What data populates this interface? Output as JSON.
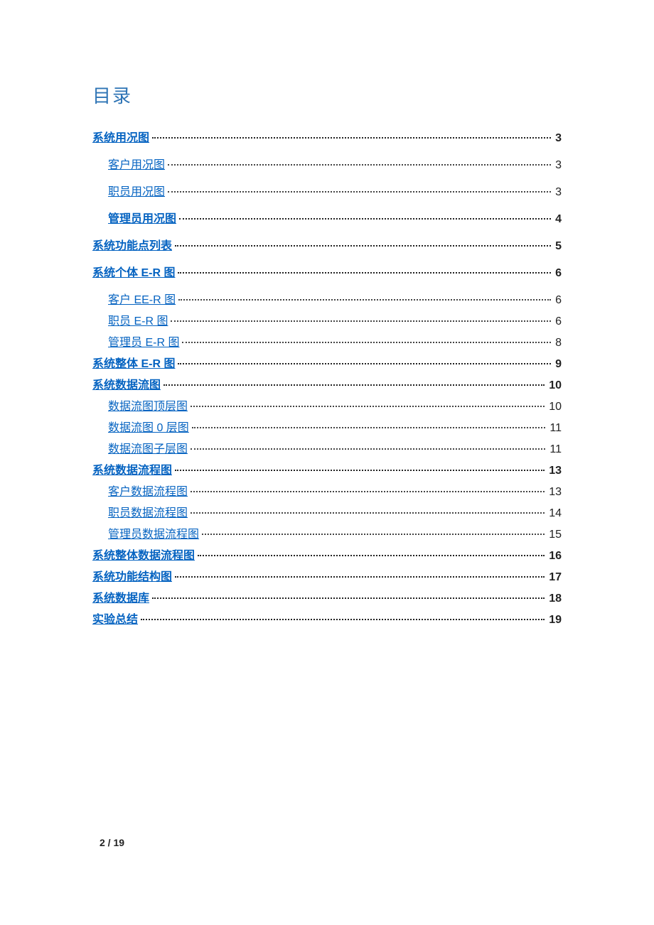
{
  "title": "目录",
  "entries": [
    {
      "label": "系统用况图",
      "page": "3",
      "level": 1,
      "bold": true,
      "spaced": true
    },
    {
      "label": "客户用况图",
      "page": "3",
      "level": 2,
      "bold": false,
      "spaced": true
    },
    {
      "label": "职员用况图",
      "page": "3",
      "level": 2,
      "bold": false,
      "spaced": true
    },
    {
      "label": "管理员用况图",
      "page": "4",
      "level": 2,
      "bold": true,
      "spaced": true
    },
    {
      "label": "系统功能点列表",
      "page": "5",
      "level": 1,
      "bold": true,
      "spaced": true
    },
    {
      "label": "系统个体 E-R 图",
      "page": "6",
      "level": 1,
      "bold": true,
      "spaced": true
    },
    {
      "label": "客户 EE-R 图",
      "page": "6",
      "level": 2,
      "bold": false,
      "spaced": false
    },
    {
      "label": "职员 E-R 图",
      "page": "6",
      "level": 2,
      "bold": false,
      "spaced": false
    },
    {
      "label": "管理员 E-R 图",
      "page": "8",
      "level": 2,
      "bold": false,
      "spaced": false
    },
    {
      "label": "系统整体 E-R 图",
      "page": "9",
      "level": 1,
      "bold": true,
      "spaced": false
    },
    {
      "label": "系统数据流图",
      "page": "10",
      "level": 1,
      "bold": true,
      "spaced": false
    },
    {
      "label": "数据流图顶层图",
      "page": "10",
      "level": 2,
      "bold": false,
      "spaced": false
    },
    {
      "label": "数据流图 0 层图",
      "page": "11",
      "level": 2,
      "bold": false,
      "spaced": false
    },
    {
      "label": "数据流图子层图",
      "page": "11",
      "level": 2,
      "bold": false,
      "spaced": false
    },
    {
      "label": "系统数据流程图",
      "page": "13",
      "level": 1,
      "bold": true,
      "spaced": false
    },
    {
      "label": "客户数据流程图",
      "page": "13",
      "level": 2,
      "bold": false,
      "spaced": false
    },
    {
      "label": "职员数据流程图",
      "page": "14",
      "level": 2,
      "bold": false,
      "spaced": false
    },
    {
      "label": "管理员数据流程图",
      "page": "15",
      "level": 2,
      "bold": false,
      "spaced": false
    },
    {
      "label": "系统整体数据流程图",
      "page": "16",
      "level": 1,
      "bold": true,
      "spaced": false
    },
    {
      "label": "系统功能结构图",
      "page": "17",
      "level": 1,
      "bold": true,
      "spaced": false
    },
    {
      "label": "系统数据库",
      "page": "18",
      "level": 1,
      "bold": true,
      "spaced": false
    },
    {
      "label": "实验总结",
      "page": "19",
      "level": 1,
      "bold": true,
      "spaced": false
    }
  ],
  "footer": "2 / 19"
}
